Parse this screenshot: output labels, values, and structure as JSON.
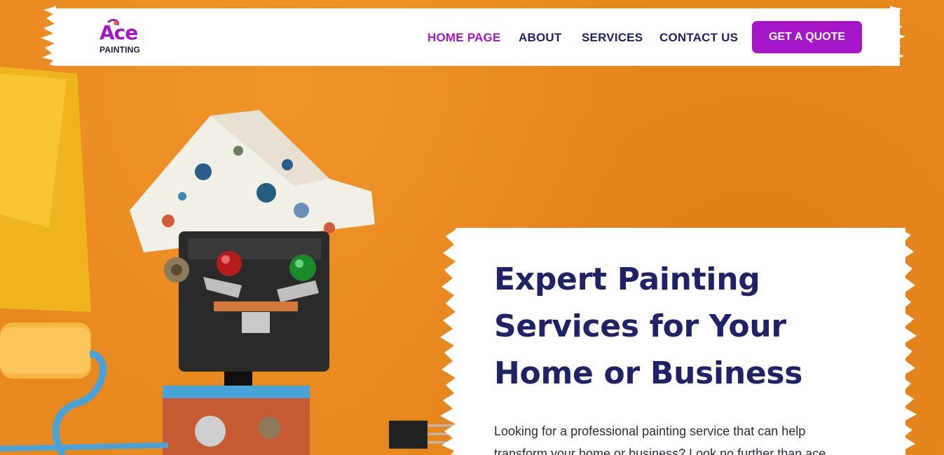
{
  "brand": {
    "logo_text": "Ace",
    "logo_subtext": "PAINTING",
    "colors": {
      "primary": "#a416c8",
      "navy": "#1f2266",
      "background_orange": "#e8891f"
    }
  },
  "nav": {
    "items": [
      {
        "label": "HOME PAGE",
        "active": true
      },
      {
        "label": "ABOUT",
        "active": false
      },
      {
        "label": "SERVICES",
        "active": false
      },
      {
        "label": "CONTACT US",
        "active": false
      }
    ],
    "cta_label": "GET A QUOTE"
  },
  "hero": {
    "title": "Expert Painting Services for Your Home or Business",
    "text": "Looking for a professional painting service that can help transform your home or business? Look no further than ace"
  },
  "icons": {
    "logo": "ace-painting-logo",
    "illustration": "robot-with-paper-hat-and-paint-roller"
  }
}
